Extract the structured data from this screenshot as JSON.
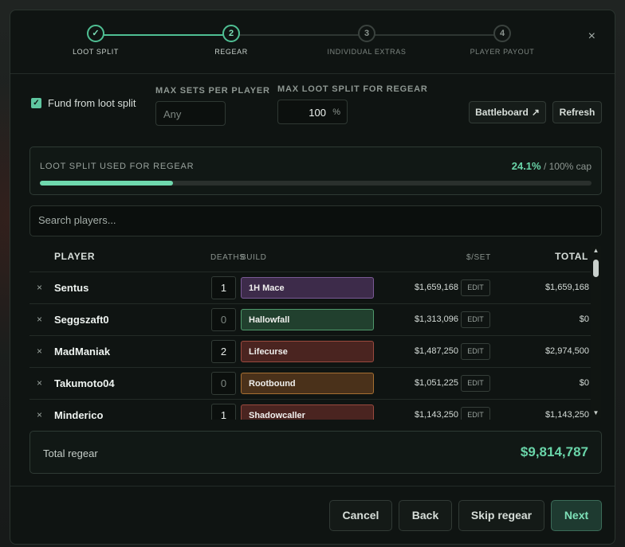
{
  "steps": [
    {
      "num": "✓",
      "label": "LOOT SPLIT"
    },
    {
      "num": "2",
      "label": "REGEAR"
    },
    {
      "num": "3",
      "label": "INDIVIDUAL EXTRAS"
    },
    {
      "num": "4",
      "label": "PLAYER PAYOUT"
    }
  ],
  "close_label": "×",
  "options": {
    "fund_checkbox": {
      "checked": true,
      "mark": "✓",
      "label": "Fund from loot split"
    },
    "max_sets_label": "MAX SETS PER PLAYER",
    "max_sets_placeholder": "Any",
    "max_loot_label": "MAX LOOT SPLIT FOR REGEAR",
    "max_loot_value": "100",
    "max_loot_unit": "%",
    "battleboard_label": "Battleboard",
    "battleboard_icon": "↗",
    "refresh_label": "Refresh"
  },
  "progress": {
    "label": "LOOT SPLIT USED FOR REGEAR",
    "value_text": "24.1%",
    "cap_text": "/ 100% cap",
    "fraction": 0.241
  },
  "search": {
    "placeholder": "Search players..."
  },
  "table": {
    "headers": {
      "player": "PLAYER",
      "deaths": "DEATHS",
      "build": "BUILD",
      "per_set": "$/SET",
      "total": "TOTAL"
    },
    "edit_label": "EDIT",
    "remove_icon": "×",
    "rows": [
      {
        "player": "Sentus",
        "deaths": "1",
        "build": "1H Mace",
        "build_color": "#3d2b4a",
        "build_border": "#7a5a96",
        "per_set": "$1,659,168",
        "total": "$1,659,168"
      },
      {
        "player": "Seggszaft0",
        "deaths": "0",
        "build": "Hallowfall",
        "build_color": "#21402e",
        "build_border": "#4f9a6c",
        "per_set": "$1,313,096",
        "total": "$0"
      },
      {
        "player": "MadManiak",
        "deaths": "2",
        "build": "Lifecurse",
        "build_color": "#4a2420",
        "build_border": "#9a4a3e",
        "per_set": "$1,487,250",
        "total": "$2,974,500"
      },
      {
        "player": "Takumoto04",
        "deaths": "0",
        "build": "Rootbound",
        "build_color": "#4a311a",
        "build_border": "#a66f32",
        "per_set": "$1,051,225",
        "total": "$0"
      },
      {
        "player": "Minderico",
        "deaths": "1",
        "build": "Shadowcaller",
        "build_color": "#4a2420",
        "build_border": "#9a4a3e",
        "per_set": "$1,143,250",
        "total": "$1,143,250"
      }
    ]
  },
  "total_regear": {
    "label": "Total regear",
    "value": "$9,814,787"
  },
  "footer": {
    "cancel": "Cancel",
    "back": "Back",
    "skip": "Skip regear",
    "next": "Next"
  },
  "colors": {
    "accent": "#69d4a8",
    "background": "#0f1412"
  }
}
